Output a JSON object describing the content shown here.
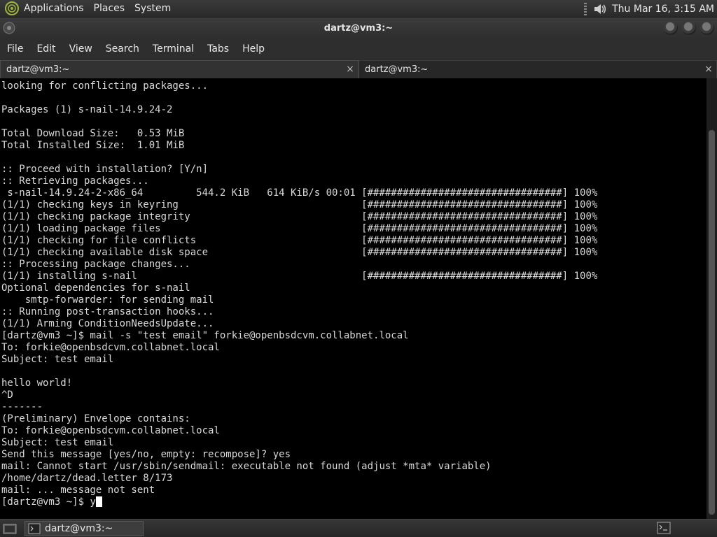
{
  "top_panel": {
    "menus": [
      "Applications",
      "Places",
      "System"
    ],
    "clock": "Thu Mar 16,  3:15 AM"
  },
  "window": {
    "title": "dartz@vm3:~"
  },
  "menu_bar": [
    "File",
    "Edit",
    "View",
    "Search",
    "Terminal",
    "Tabs",
    "Help"
  ],
  "tabs": [
    {
      "label": "dartz@vm3:~",
      "close": "×"
    },
    {
      "label": "dartz@vm3:~",
      "close": "×"
    }
  ],
  "terminal": {
    "lines": [
      "looking for conflicting packages...",
      "",
      "Packages (1) s-nail-14.9.24-2",
      "",
      "Total Download Size:   0.53 MiB",
      "Total Installed Size:  1.01 MiB",
      "",
      ":: Proceed with installation? [Y/n]",
      ":: Retrieving packages...",
      " s-nail-14.9.24-2-x86_64         544.2 KiB   614 KiB/s 00:01 [#################################] 100%",
      "(1/1) checking keys in keyring                               [#################################] 100%",
      "(1/1) checking package integrity                             [#################################] 100%",
      "(1/1) loading package files                                  [#################################] 100%",
      "(1/1) checking for file conflicts                            [#################################] 100%",
      "(1/1) checking available disk space                          [#################################] 100%",
      ":: Processing package changes...",
      "(1/1) installing s-nail                                      [#################################] 100%",
      "Optional dependencies for s-nail",
      "    smtp-forwarder: for sending mail",
      ":: Running post-transaction hooks...",
      "(1/1) Arming ConditionNeedsUpdate...",
      "[dartz@vm3 ~]$ mail -s \"test email\" forkie@openbsdcvm.collabnet.local",
      "To: forkie@openbsdcvm.collabnet.local",
      "Subject: test email",
      "",
      "hello world!",
      "^D",
      "-------",
      "(Preliminary) Envelope contains:",
      "To: forkie@openbsdcvm.collabnet.local",
      "Subject: test email",
      "Send this message [yes/no, empty: recompose]? yes",
      "mail: Cannot start /usr/sbin/sendmail: executable not found (adjust *mta* variable)",
      "/home/dartz/dead.letter 8/173",
      "mail: ... message not sent"
    ],
    "prompt": "[dartz@vm3 ~]$ ",
    "input": "y"
  },
  "taskbar": {
    "window_label": "dartz@vm3:~"
  }
}
